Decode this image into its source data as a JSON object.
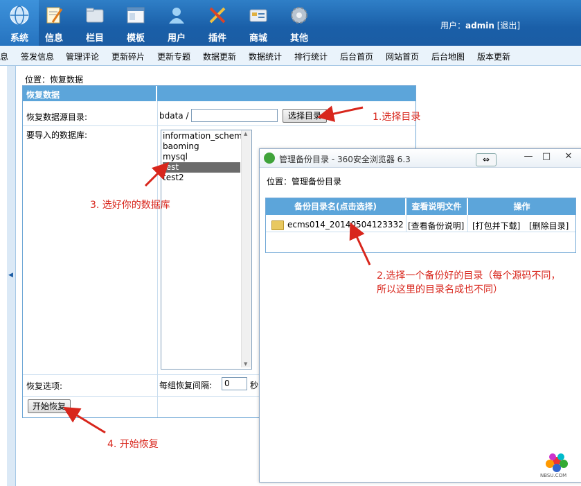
{
  "colors": {
    "nav_bg": "#1b5ca3",
    "header_bg": "#5ca5da",
    "annotation": "#d8261c",
    "selected_option": "#6b6b6b"
  },
  "nav": {
    "items": [
      {
        "label": "系统",
        "icon": "globe-icon"
      },
      {
        "label": "信息",
        "icon": "note-pencil-icon"
      },
      {
        "label": "栏目",
        "icon": "folder-icon"
      },
      {
        "label": "模板",
        "icon": "window-template-icon"
      },
      {
        "label": "用户",
        "icon": "user-icon"
      },
      {
        "label": "插件",
        "icon": "tools-icon"
      },
      {
        "label": "商城",
        "icon": "card-icon"
      },
      {
        "label": "其他",
        "icon": "gear-icon"
      }
    ],
    "user_label": "用户：",
    "username": "admin",
    "logout": "[退出]"
  },
  "submenu": {
    "items": [
      "息",
      "签发信息",
      "管理评论",
      "更新碎片",
      "更新专题",
      "数据更新",
      "数据统计",
      "排行统计",
      "后台首页",
      "网站首页",
      "后台地图",
      "版本更新"
    ]
  },
  "main": {
    "location": "位置：恢复数据",
    "table_title": "恢复数据",
    "source_dir_label": "恢复数据源目录:",
    "source_dir_prefix": "bdata /",
    "source_dir_value": "",
    "choose_dir_button": "选择目录",
    "db_label": "要导入的数据库:",
    "databases": [
      "information_schema",
      "baoming",
      "mysql",
      "test",
      "test2"
    ],
    "selected_db": "test",
    "options_label": "恢复选项:",
    "interval_label": "每组恢复间隔:",
    "interval_value": "0",
    "interval_unit": "秒",
    "start_button": "开始恢复"
  },
  "popup": {
    "title": "管理备份目录 - 360安全浏览器 6.3",
    "restore_glyph": "⇔",
    "location": "位置：管理备份目录",
    "columns": [
      "备份目录名(点击选择)",
      "查看说明文件",
      "操作"
    ],
    "row": {
      "name": "ecms014_20140504123332",
      "view": "[查看备份说明]",
      "pack": "[打包并下载]",
      "delete": "[删除目录]"
    }
  },
  "annotations": {
    "step1": "1.选择目录",
    "step2": "2.选择一个备份好的目录（每个源码不同，所以这里的目录名成也不同）",
    "step3": "3. 选好你的数据库",
    "step4": "4. 开始恢复"
  },
  "watermark": "NBSU.COM"
}
